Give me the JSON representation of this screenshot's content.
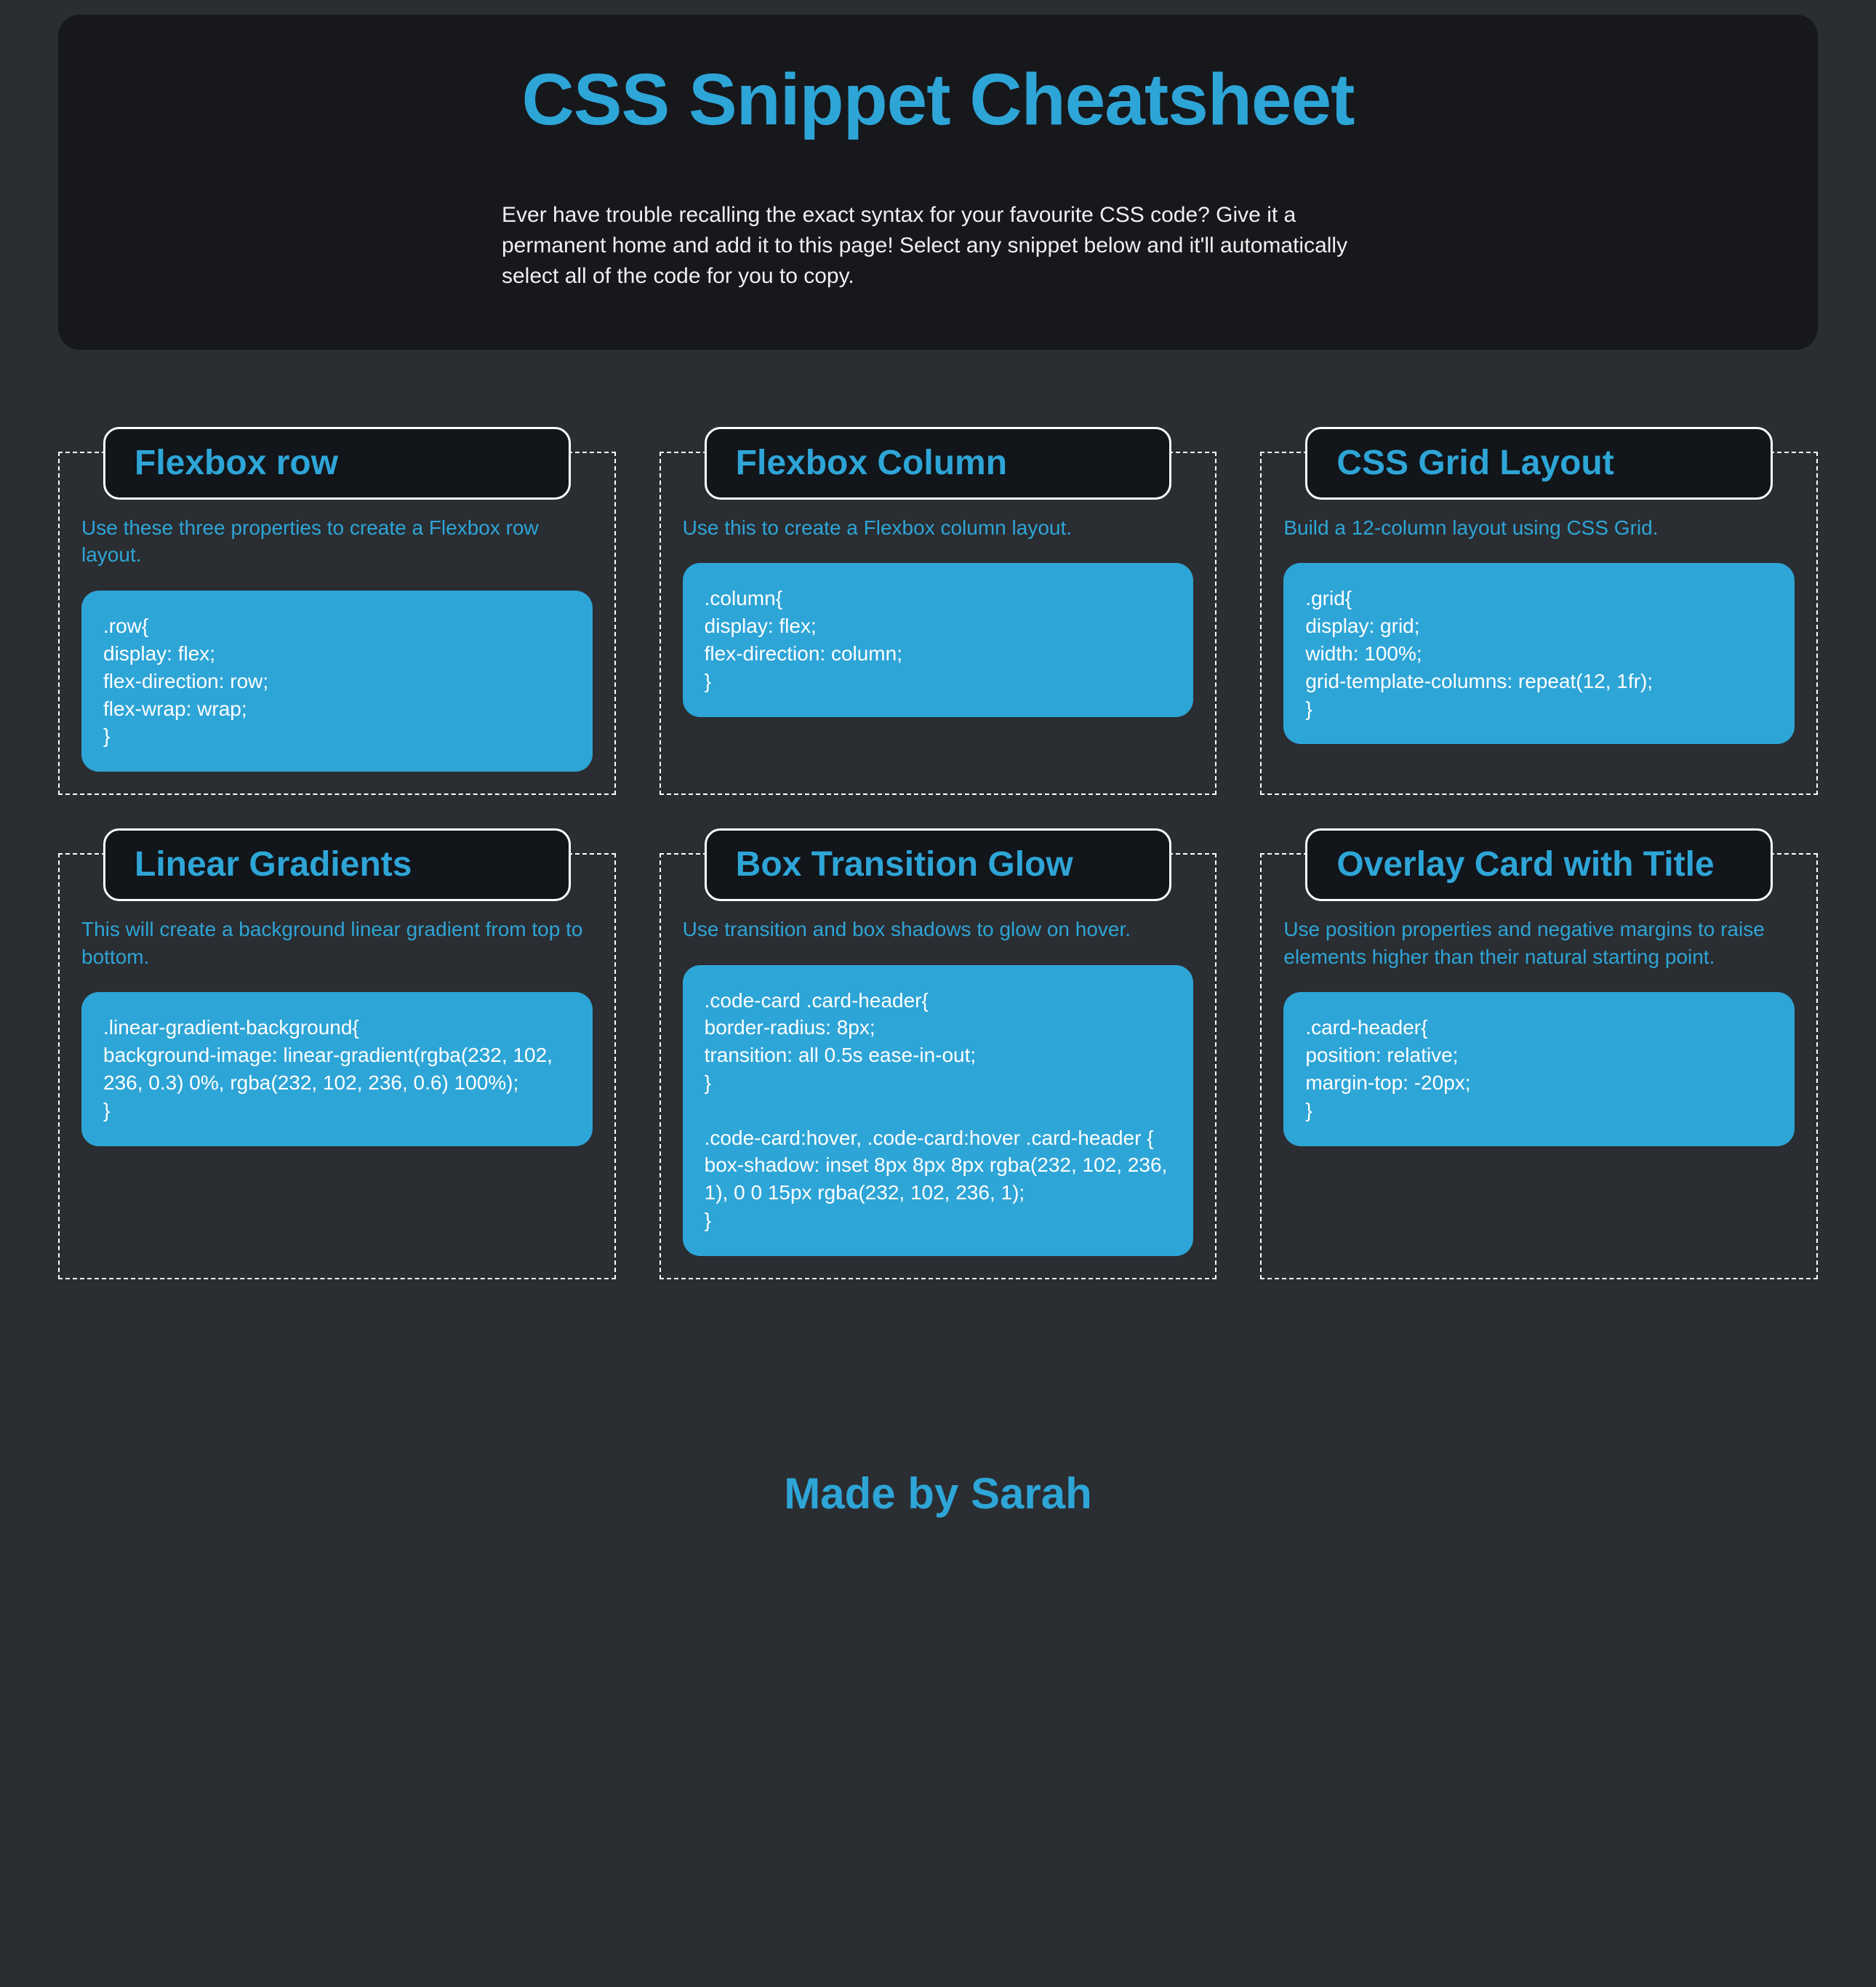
{
  "header": {
    "title": "CSS Snippet Cheatsheet",
    "subtitle": "Ever have trouble recalling the exact syntax for your favourite CSS code? Give it a permanent home and add it to this page! Select any snippet below and it'll automatically select all of the code for you to copy."
  },
  "cards": [
    {
      "title": "Flexbox row",
      "desc": "Use these three properties to create a Flexbox row layout.",
      "code": ".row{\ndisplay: flex;\nflex-direction: row;\nflex-wrap: wrap;\n}"
    },
    {
      "title": "Flexbox Column",
      "desc": "Use this to create a Flexbox column layout.",
      "code": ".column{\ndisplay: flex;\nflex-direction: column;\n}"
    },
    {
      "title": "CSS Grid Layout",
      "desc": "Build a 12-column layout using CSS Grid.",
      "code": ".grid{\ndisplay: grid;\nwidth: 100%;\ngrid-template-columns: repeat(12, 1fr);\n}"
    },
    {
      "title": "Linear Gradients",
      "desc": "This will create a background linear gradient from top to bottom.",
      "code": ".linear-gradient-background{\nbackground-image: linear-gradient(rgba(232, 102, 236, 0.3) 0%, rgba(232, 102, 236, 0.6) 100%);\n}"
    },
    {
      "title": "Box Transition Glow",
      "desc": "Use transition and box shadows to glow on hover.",
      "code": ".code-card .card-header{\nborder-radius: 8px;\ntransition: all 0.5s ease-in-out;\n}\n\n.code-card:hover, .code-card:hover .card-header {\nbox-shadow: inset 8px 8px 8px rgba(232, 102, 236, 1), 0 0 15px rgba(232, 102, 236, 1);\n}"
    },
    {
      "title": "Overlay Card with Title",
      "desc": "Use position properties and negative margins to raise elements higher than their natural starting point.",
      "code": ".card-header{\nposition: relative;\nmargin-top: -20px;\n}"
    }
  ],
  "footer": {
    "text": "Made by Sarah"
  }
}
